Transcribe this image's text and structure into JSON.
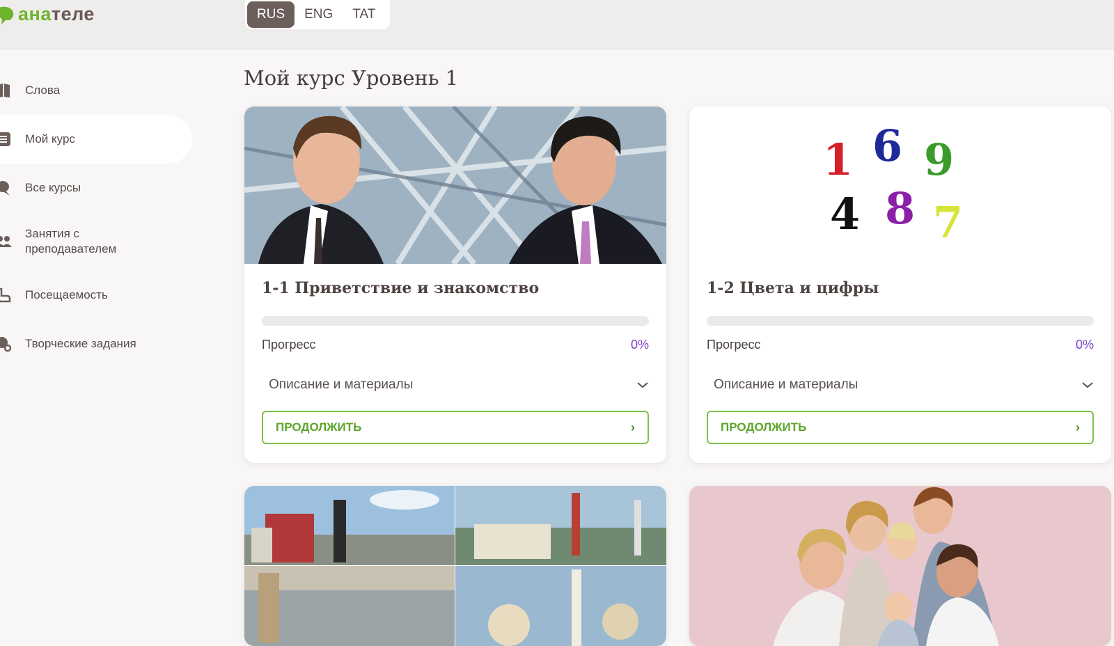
{
  "app": {
    "logo_part1": "ана",
    "logo_part2": "теле",
    "brand_colors": {
      "green": "#6fb52c",
      "brown": "#675a58",
      "accent": "#7b3fd1",
      "button": "#7fc048"
    }
  },
  "languages": [
    {
      "label": "RUS",
      "active": true
    },
    {
      "label": "ENG",
      "active": false
    },
    {
      "label": "TAT",
      "active": false
    }
  ],
  "sidebar": {
    "items": [
      {
        "label": "Слова",
        "icon": "book-icon"
      },
      {
        "label": "Мой курс",
        "icon": "list-icon",
        "active": true
      },
      {
        "label": "Все курсы",
        "icon": "chat-icon"
      },
      {
        "label": "Занятия с преподавателем",
        "icon": "users-icon"
      },
      {
        "label": "Посещаемость",
        "icon": "hand-icon"
      },
      {
        "label": "Творческие задания",
        "icon": "palette-icon"
      }
    ]
  },
  "main": {
    "title": "Мой курс Уровень 1",
    "cards": [
      {
        "title": "1-1 Приветствие и знакомство",
        "image": "photo-two-businessmen",
        "progress_label": "Прогресс",
        "progress_value": "0%",
        "progress_fraction": 0,
        "description_label": "Описание и материалы",
        "button_label": "ПРОДОЛЖИТЬ"
      },
      {
        "title": "1-2 Цвета и цифры",
        "image": "numbers-illustration",
        "numbers": [
          "1",
          "6",
          "9",
          "4",
          "8",
          "7"
        ],
        "progress_label": "Прогресс",
        "progress_value": "0%",
        "progress_fraction": 0,
        "description_label": "Описание и материалы",
        "button_label": "ПРОДОЛЖИТЬ"
      },
      {
        "image": "photo-city-collage"
      },
      {
        "image": "photo-family"
      }
    ]
  }
}
